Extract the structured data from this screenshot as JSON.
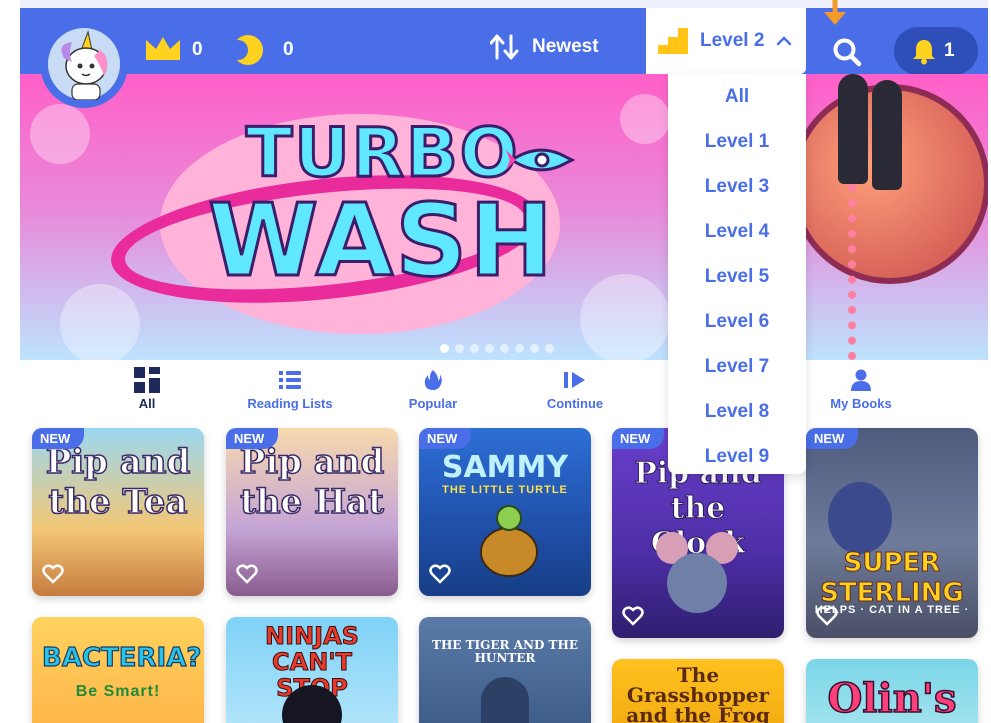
{
  "header": {
    "crowns": "0",
    "coins": "0",
    "sort_label": "Newest",
    "level_label": "Level 2",
    "notifications": "1",
    "accent": "#4a6ee8"
  },
  "banner": {
    "title_line1": "TURBO",
    "title_line2": "WASH",
    "slides": 8,
    "active_slide": 1
  },
  "level_menu": {
    "options": [
      "All",
      "Level 1",
      "Level 3",
      "Level 4",
      "Level 5",
      "Level 6",
      "Level 7",
      "Level 8",
      "Level 9"
    ]
  },
  "tabs": [
    {
      "label": "All",
      "icon": "grid-icon"
    },
    {
      "label": "Reading Lists",
      "icon": "list-icon"
    },
    {
      "label": "Popular",
      "icon": "flame-icon"
    },
    {
      "label": "Continue",
      "icon": "play-icon"
    },
    {
      "label": "My Books",
      "icon": "person-icon"
    }
  ],
  "books": [
    {
      "title": "Pip and the Tea",
      "badge": "NEW"
    },
    {
      "title": "Pip and the Hat",
      "badge": "NEW"
    },
    {
      "title": "SAMMY",
      "subtitle": "THE LITTLE TURTLE",
      "badge": "NEW"
    },
    {
      "title": "Pip and the Clock",
      "badge": "NEW"
    },
    {
      "title": "SUPER STERLING",
      "subtitle": "HELPS · CAT IN A TREE ·",
      "badge": "NEW"
    },
    {
      "title": "BACTERIA?",
      "subtitle": "Be Smart!"
    },
    {
      "title": "NINJAS CAN'T STOP"
    },
    {
      "title": "THE TIGER AND THE HUNTER"
    },
    {
      "title": "The Grasshopper and the Frog"
    },
    {
      "title": "Olin's"
    }
  ]
}
